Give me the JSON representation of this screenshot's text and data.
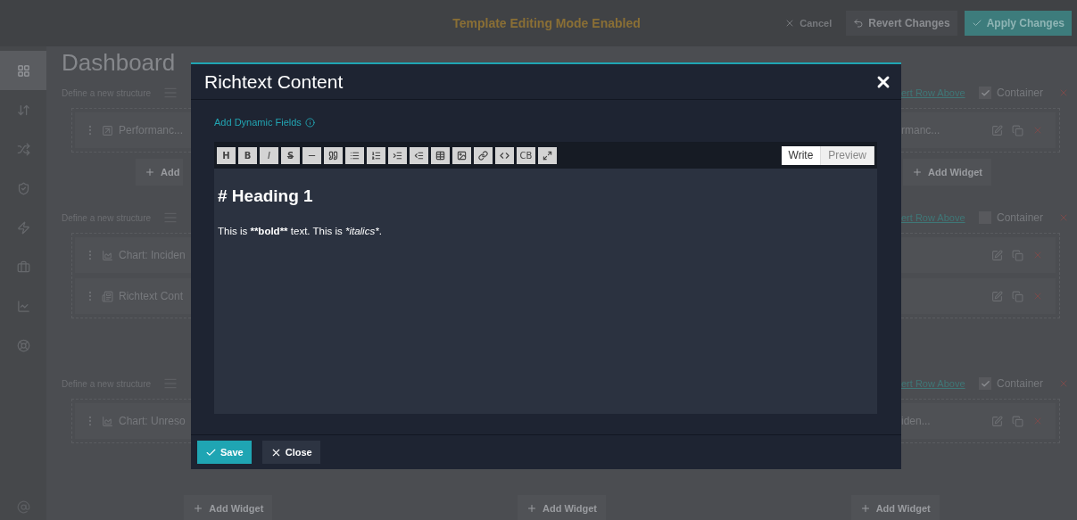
{
  "top_bar": {
    "title": "Template Editing Mode Enabled",
    "actions": [
      {
        "kind": "link",
        "label": "Cancel"
      },
      {
        "kind": "secondary",
        "label": "Revert Changes"
      },
      {
        "kind": "primary",
        "label": "Apply Changes"
      }
    ]
  },
  "sidebar": {
    "items": [
      {
        "selected": true
      },
      {
        "selected": false
      },
      {
        "selected": false
      },
      {
        "selected": false
      },
      {
        "selected": false
      },
      {
        "selected": false
      },
      {
        "selected": false
      },
      {
        "selected": false
      }
    ]
  },
  "page": {
    "title": "Dashboard"
  },
  "rows": [
    {
      "structure_label": "Define a new structure",
      "insert_link": "ert Row Above",
      "container": true,
      "container_label": "Container",
      "widgets": [
        {
          "kind": "metric",
          "left": "Performanc...",
          "right": "rmanc..."
        }
      ],
      "add_left": "Add",
      "add_right": "Add Widget"
    },
    {
      "structure_label": "Define a new structure",
      "insert_link": "ert Row Above",
      "container": false,
      "container_label": "Container",
      "widgets": [
        {
          "kind": "chart",
          "left": "Chart: Inciden"
        },
        {
          "kind": "richtext",
          "left": "Richtext Cont"
        }
      ]
    },
    {
      "structure_label": "Define a new structure",
      "insert_link": "ert Row Above",
      "container": true,
      "container_label": "Container",
      "widgets": [
        {
          "kind": "chart",
          "left": "Chart: Unreso",
          "right": "iden..."
        }
      ]
    }
  ],
  "add_widget_buttons": [
    "Add Widget",
    "Add Widget",
    "Add Widget"
  ],
  "modal": {
    "title": "Richtext Content",
    "dynamic_fields_link": "Add Dynamic Fields",
    "toolbar": [
      {
        "kind": "heading",
        "label": "H"
      },
      {
        "kind": "bold",
        "label": "B"
      },
      {
        "kind": "italic",
        "label": "I"
      },
      {
        "kind": "strike",
        "label": "S"
      },
      {
        "kind": "icon"
      },
      {
        "kind": "icon"
      },
      {
        "kind": "icon"
      },
      {
        "kind": "icon"
      },
      {
        "kind": "icon"
      },
      {
        "kind": "icon"
      },
      {
        "kind": "icon"
      },
      {
        "kind": "icon"
      },
      {
        "kind": "icon"
      },
      {
        "kind": "icon"
      },
      {
        "kind": "plain",
        "label": "CB"
      },
      {
        "kind": "icon"
      }
    ],
    "tabs": [
      {
        "label": "Write",
        "selected": true
      },
      {
        "label": "Preview",
        "selected": false
      }
    ],
    "content": {
      "heading": "# Heading 1",
      "paragraph": [
        {
          "kind": "normal",
          "text": "This is "
        },
        {
          "kind": "bold",
          "text": "**bold**"
        },
        {
          "kind": "normal",
          "text": " text. This is "
        },
        {
          "kind": "italic",
          "text": "*italics*"
        },
        {
          "kind": "normal",
          "text": "."
        }
      ]
    },
    "buttons": [
      {
        "kind": "primary",
        "label": "Save"
      },
      {
        "kind": "secondary",
        "label": "Close"
      }
    ]
  }
}
